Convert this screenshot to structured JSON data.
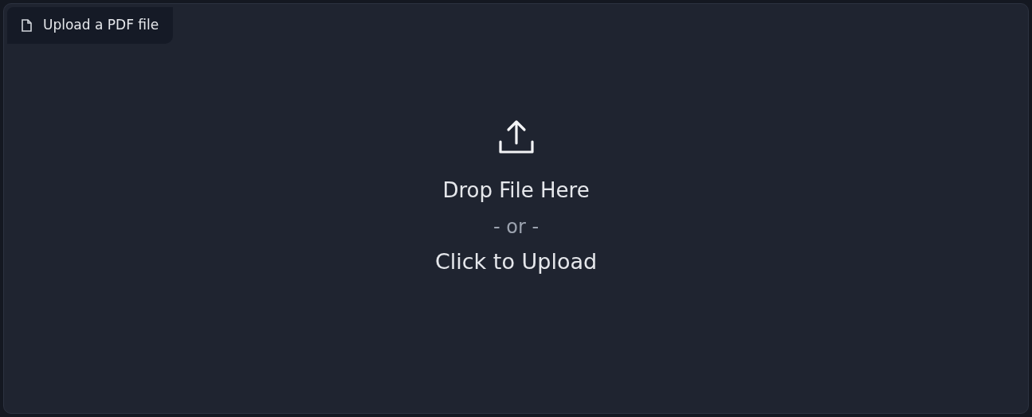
{
  "label": "Upload a PDF file",
  "dropzone": {
    "title": "Drop File Here",
    "separator": "- or -",
    "action": "Click to Upload"
  }
}
